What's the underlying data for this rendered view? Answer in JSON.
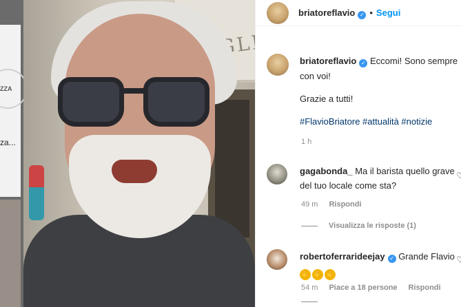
{
  "prev_post": {
    "logo_text": "ZZA",
    "caption_fragment": "za..."
  },
  "media": {
    "sign_text": "GLES"
  },
  "header": {
    "username": "briatoreflavio",
    "follow_label": "Segui"
  },
  "caption": {
    "username": "briatoreflavio",
    "line1": "Eccomi! Sono sempre con voi!",
    "line2": "Grazie a tutti!",
    "hashtags": "#FlavioBriatore #attualità #notizie",
    "time": "1 h"
  },
  "comments": [
    {
      "username": "gagabonda_",
      "text": "Ma il barista quello grave del tuo locale come sta?",
      "time": "49 m",
      "reply_label": "Rispondi",
      "view_replies": "Visualizza le risposte (1)"
    },
    {
      "username": "robertoferrarideejay",
      "text": "Grande Flavio",
      "emoji_count": 3,
      "time": "54 m",
      "likes_label": "Piace a 18 persone",
      "reply_label": "Rispondi"
    }
  ],
  "icons": {
    "verified": "verified-badge-icon",
    "like": "heart-icon",
    "clap": "clapping-hands-icon"
  },
  "colors": {
    "link_blue": "#0095f6",
    "hashtag": "#00376b",
    "verified": "#3897f0",
    "muted": "#8e8e8e"
  }
}
